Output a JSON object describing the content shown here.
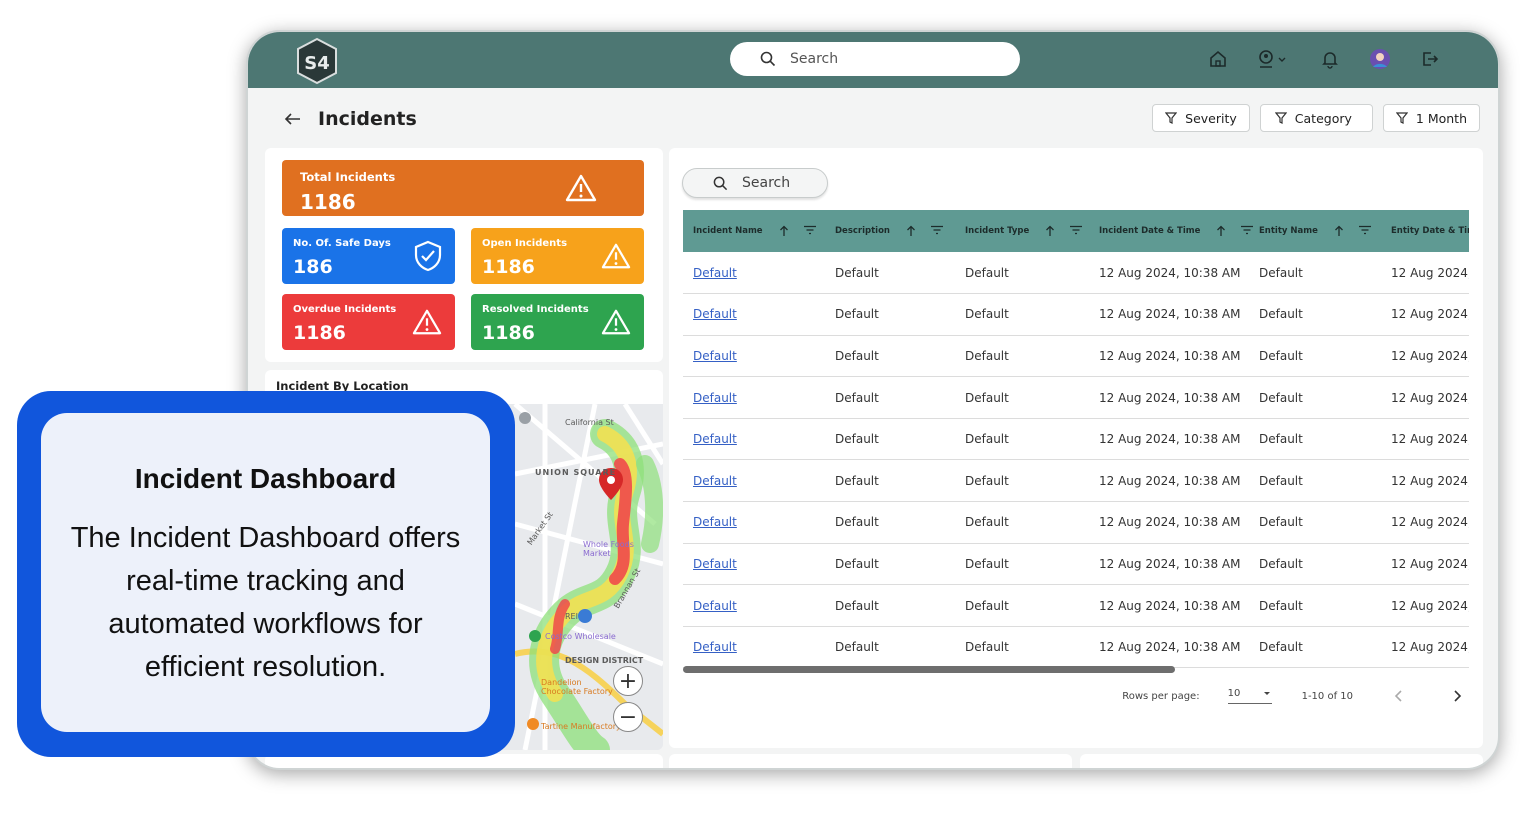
{
  "header": {
    "search_placeholder": "Search"
  },
  "page": {
    "title": "Incidents"
  },
  "filters": [
    {
      "label": "Severity"
    },
    {
      "label": "Category"
    },
    {
      "label": "1 Month"
    }
  ],
  "stats": {
    "total": {
      "label": "Total Incidents",
      "value": "1186",
      "color": "#e07020"
    },
    "safe_days": {
      "label": "No. Of. Safe Days",
      "value": "186",
      "color": "#1a73e8"
    },
    "open": {
      "label": "Open Incidents",
      "value": "1186",
      "color": "#f7a21b"
    },
    "overdue": {
      "label": "Overdue Incidents",
      "value": "1186",
      "color": "#ec3b3b"
    },
    "resolved": {
      "label": "Resolved Incidents",
      "value": "1186",
      "color": "#2ea44f"
    }
  },
  "map": {
    "title": "Incident By Location",
    "labels": [
      "California St",
      "UNION SQUARE",
      "Whole Foods Market",
      "REI",
      "Costco Wholesale",
      "DESIGN DISTRICT",
      "Dandelion Chocolate Factory",
      "Tartine Manufactory",
      "Market St",
      "Brannan St"
    ]
  },
  "table": {
    "search_placeholder": "Search",
    "columns": [
      "Incident Name",
      "Description",
      "Incident Type",
      "Incident Date & Time",
      "Entity Name",
      "Entity Date & Time"
    ],
    "rows": [
      [
        "Default",
        "Default",
        "Default",
        "12 Aug 2024,  10:38 AM",
        "Default",
        "12 Aug 2024,"
      ],
      [
        "Default",
        "Default",
        "Default",
        "12 Aug 2024,  10:38 AM",
        "Default",
        "12 Aug 2024,"
      ],
      [
        "Default",
        "Default",
        "Default",
        "12 Aug 2024,  10:38 AM",
        "Default",
        "12 Aug 2024,"
      ],
      [
        "Default",
        "Default",
        "Default",
        "12 Aug 2024,  10:38 AM",
        "Default",
        "12 Aug 2024,"
      ],
      [
        "Default",
        "Default",
        "Default",
        "12 Aug 2024,  10:38 AM",
        "Default",
        "12 Aug 2024,"
      ],
      [
        "Default",
        "Default",
        "Default",
        "12 Aug 2024,  10:38 AM",
        "Default",
        "12 Aug 2024,"
      ],
      [
        "Default",
        "Default",
        "Default",
        "12 Aug 2024,  10:38 AM",
        "Default",
        "12 Aug 2024,"
      ],
      [
        "Default",
        "Default",
        "Default",
        "12 Aug 2024,  10:38 AM",
        "Default",
        "12 Aug 2024,"
      ],
      [
        "Default",
        "Default",
        "Default",
        "12 Aug 2024,  10:38 AM",
        "Default",
        "12 Aug 2024,"
      ],
      [
        "Default",
        "Default",
        "Default",
        "12 Aug 2024,  10:38 AM",
        "Default",
        "12 Aug 2024,"
      ]
    ],
    "pagination": {
      "rows_per_page_label": "Rows per page:",
      "rows_per_page": "10",
      "range": "1-10 of 10"
    }
  },
  "callout": {
    "title": "Incident Dashboard",
    "body": "The Incident Dashboard offers real-time tracking and automated workflows for efficient resolution."
  },
  "theme": {
    "header_bg": "#4d7773",
    "table_header_bg": "#5f9a93",
    "callout_border": "#1156dc",
    "link": "#3560c5"
  }
}
